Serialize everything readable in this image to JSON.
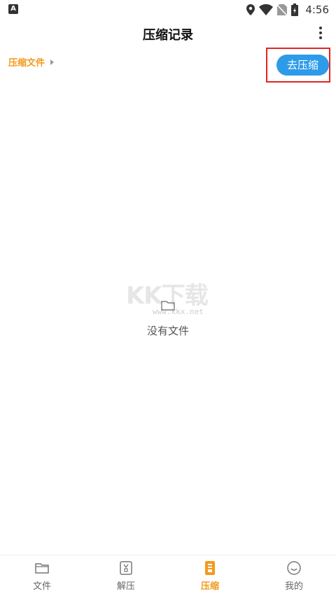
{
  "status_bar": {
    "left_icon": "A",
    "time": "4:56",
    "icons": [
      "location-icon",
      "wifi-icon",
      "no-sim-icon",
      "battery-icon"
    ]
  },
  "toolbar": {
    "title": "压缩记录",
    "more_icon": "more-vertical-icon"
  },
  "breadcrumb": {
    "label": "压缩文件"
  },
  "actions": {
    "go_compress_label": "去压缩",
    "accent_color": "#2D9BE8",
    "highlight_color": "#E32424"
  },
  "empty_state": {
    "icon": "empty-folder-icon",
    "text": "没有文件"
  },
  "watermark": {
    "logo": "KK下载",
    "url": "www.kkx.net"
  },
  "bottom_nav": {
    "items": [
      {
        "label": "文件",
        "icon": "folder-icon",
        "active": false
      },
      {
        "label": "解压",
        "icon": "unzip-icon",
        "active": false
      },
      {
        "label": "压缩",
        "icon": "compress-icon",
        "active": true
      },
      {
        "label": "我的",
        "icon": "smiley-icon",
        "active": false
      }
    ],
    "active_color": "#F29A1D"
  }
}
